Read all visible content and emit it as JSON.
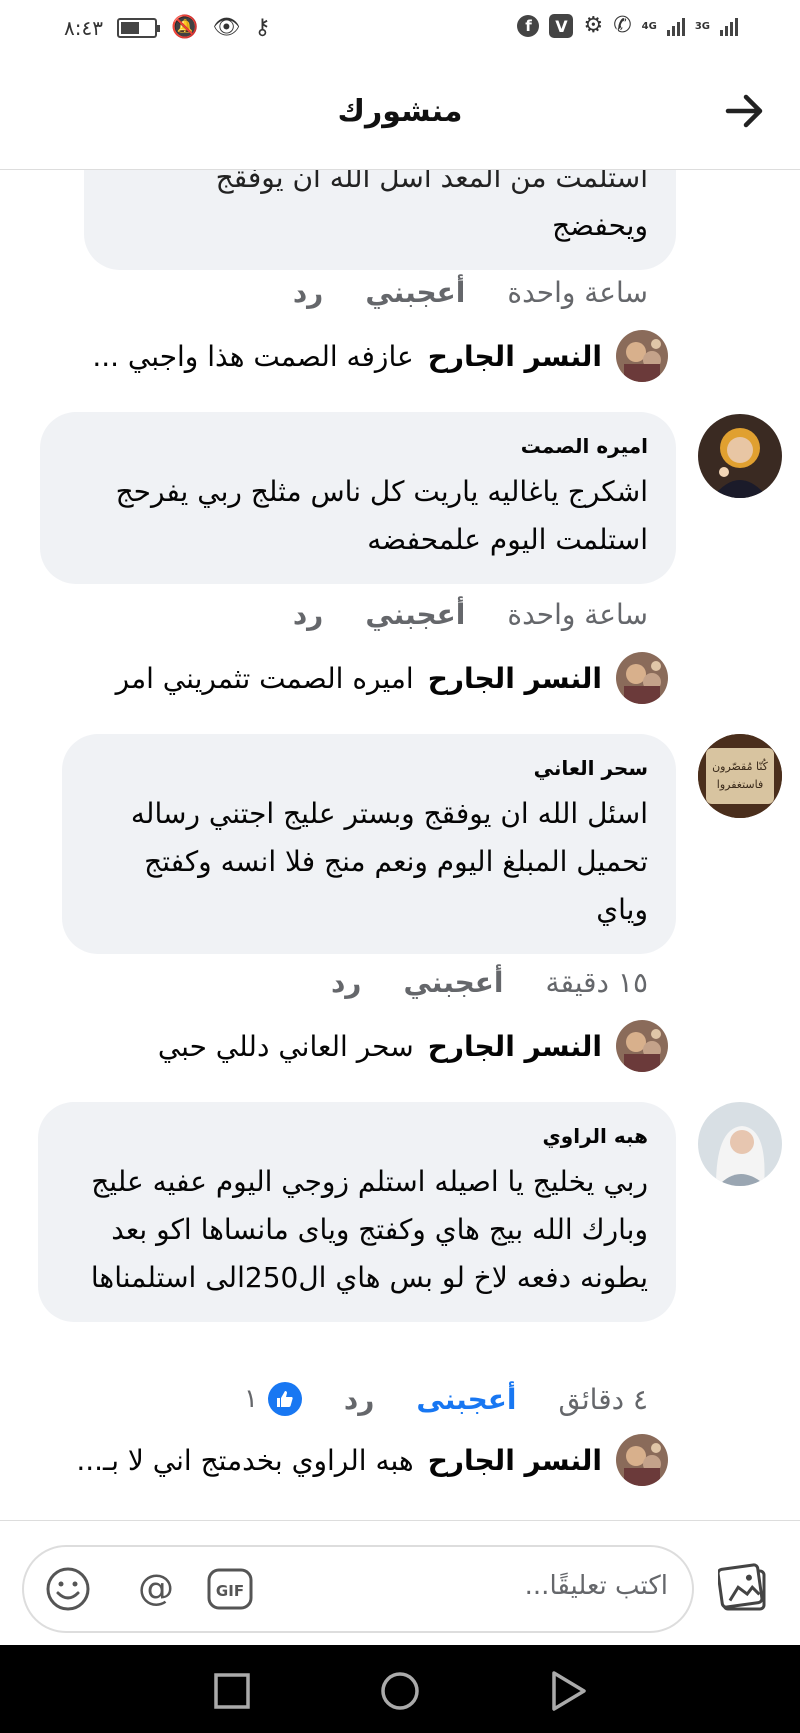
{
  "status": {
    "time": "٨:٤٣",
    "net_top": "4G",
    "net_3g": "3G",
    "battery_level": 0.55
  },
  "header": {
    "title": "منشورك"
  },
  "thread": {
    "partial_comment": {
      "text_cut": "استلمت من المعد اسل الله ان يوفقج",
      "text_last": "ويحفضج",
      "time": "ساعة واحدة",
      "like": "أعجبني",
      "reply": "رد"
    },
    "reply1": {
      "name": "النسر الجارح",
      "text": "عازفه الصمت هذا واجبي ..."
    },
    "comment1": {
      "author": "اميره الصمت",
      "text": "اشكرج ياغاليه ياريت كل ناس مثلج ربي يفرحج استلمت اليوم علمحفضه",
      "time": "ساعة واحدة",
      "like": "أعجبني",
      "reply": "رد"
    },
    "reply2": {
      "name": "النسر الجارح",
      "text": "اميره الصمت تثمريني امر"
    },
    "comment2": {
      "author": "سحر العاني",
      "text": "اسئل الله ان يوفقج وبستر عليج اجتني رساله تحميل المبلغ اليوم ونعم منج فلا انسه وكفتج وياي",
      "avatar_text_1": "كُنّا مُقصّرون",
      "avatar_text_2": "فاستغفروا",
      "time": "١٥ دقيقة",
      "like": "أعجبني",
      "reply": "رد"
    },
    "reply3": {
      "name": "النسر الجارح",
      "text": "سحر العاني دللي حبي"
    },
    "comment3": {
      "author": "هبه الراوي",
      "text": "ربي يخليج يا اصيله استلم زوجي اليوم عفيه عليج وبارك الله بيج هاي وكفتج وياى مانساها اكو بعد يطونه دفعه لاخ لو بس هاي ال250الى استلمناها",
      "time": "٤ دقائق",
      "like": "أعجبنى",
      "reply": "رد",
      "reaction_count": "١"
    },
    "reply4": {
      "name": "النسر الجارح",
      "text": "هبه الراوي بخدمتج اني لا بـ..."
    }
  },
  "composer": {
    "placeholder": "اكتب تعليقًا...",
    "gif": "GIF",
    "at": "@"
  },
  "colors": {
    "accent": "#1877f2",
    "bubble": "#f0f2f5",
    "meta": "#65676b"
  }
}
